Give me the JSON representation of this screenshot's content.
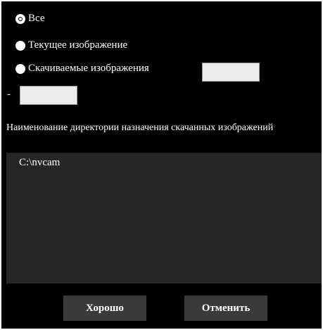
{
  "range_options": {
    "all": "Все",
    "current": "Текущее изображение",
    "downloaded": "Скачиваемые изображения",
    "selected": "all"
  },
  "range_from_value": "",
  "range_to_value": "",
  "range_dash": "-",
  "directory": {
    "label": "Наименование директории назначения скачанных изображений",
    "path": "C:\\nvcam"
  },
  "buttons": {
    "ok": "Хорошо",
    "cancel": "Отменить"
  }
}
